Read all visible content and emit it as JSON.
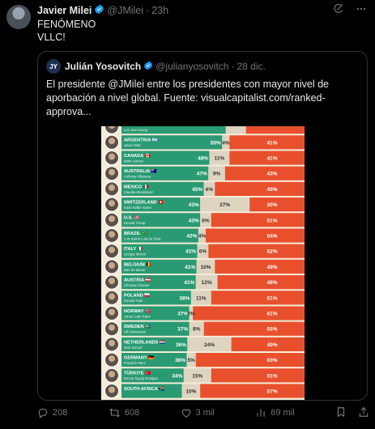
{
  "post": {
    "author_name": "Javier Milei",
    "author_handle": "@JMilei",
    "time": "23h",
    "text_line1": "FENÓMENO",
    "text_line2": "VLLC!"
  },
  "quote": {
    "author_name": "Julián Yosovitch",
    "author_handle": "@julianyosovitch",
    "time": "28 dic.",
    "text": "El presidente @JMilei entre los presidentes con mayor nivel de aporbación a nivel global. Fuente: visualcapitalist.com/ranked-approva..."
  },
  "chart_data": {
    "type": "bar",
    "stacked": true,
    "series_colors": {
      "approve": "#2a9a72",
      "neutral": "#ddd5c0",
      "disapprove": "#e8502d"
    },
    "rows": [
      {
        "country": "",
        "leader": "Lee Jae-myung",
        "flag": "",
        "approve": 57,
        "neutral": 11,
        "disapprove": 32,
        "approve_label": "",
        "neutral_label": "",
        "disapprove_label": ""
      },
      {
        "country": "ARGENTINA",
        "leader": "Javier Milei",
        "flag": "🇦🇷",
        "approve": 55,
        "neutral": 4,
        "disapprove": 41,
        "approve_label": "55%",
        "neutral_label": "4%",
        "disapprove_label": "41%"
      },
      {
        "country": "CANADA",
        "leader": "Mark Carney",
        "flag": "🇨🇦",
        "approve": 48,
        "neutral": 11,
        "disapprove": 41,
        "approve_label": "48%",
        "neutral_label": "11%",
        "disapprove_label": "41%"
      },
      {
        "country": "AUSTRALIA",
        "leader": "Anthony Albanese",
        "flag": "🇦🇺",
        "approve": 47,
        "neutral": 9,
        "disapprove": 43,
        "approve_label": "47%",
        "neutral_label": "9%",
        "disapprove_label": "43%"
      },
      {
        "country": "MEXICO",
        "leader": "Claudia Sheinbaum",
        "flag": "🇲🇽",
        "approve": 45,
        "neutral": 6,
        "disapprove": 49,
        "approve_label": "45%",
        "neutral_label": "6%",
        "disapprove_label": "49%"
      },
      {
        "country": "SWITZERLAND",
        "leader": "Karin Keller-Sutter",
        "flag": "🇨🇭",
        "approve": 43,
        "neutral": 27,
        "disapprove": 30,
        "approve_label": "43%",
        "neutral_label": "27%",
        "disapprove_label": "30%"
      },
      {
        "country": "U.S.",
        "leader": "Donald Trump",
        "flag": "🇺🇸",
        "approve": 43,
        "neutral": 6,
        "disapprove": 51,
        "approve_label": "43%",
        "neutral_label": "6%",
        "disapprove_label": "51%"
      },
      {
        "country": "BRAZIL",
        "leader": "Luiz Inácio Lula da Silva",
        "flag": "🇧🇷",
        "approve": 42,
        "neutral": 4,
        "disapprove": 54,
        "approve_label": "42%",
        "neutral_label": "4%",
        "disapprove_label": "54%"
      },
      {
        "country": "ITALY",
        "leader": "Giorgia Meloni",
        "flag": "🇮🇹",
        "approve": 41,
        "neutral": 6,
        "disapprove": 52,
        "approve_label": "41%",
        "neutral_label": "6%",
        "disapprove_label": "52%"
      },
      {
        "country": "BELGIUM",
        "leader": "Bart de Wever",
        "flag": "🇧🇪",
        "approve": 41,
        "neutral": 10,
        "disapprove": 49,
        "approve_label": "41%",
        "neutral_label": "10%",
        "disapprove_label": "49%"
      },
      {
        "country": "AUSTRIA",
        "leader": "Christian Stocker",
        "flag": "🇦🇹",
        "approve": 41,
        "neutral": 12,
        "disapprove": 48,
        "approve_label": "41%",
        "neutral_label": "12%",
        "disapprove_label": "48%"
      },
      {
        "country": "POLAND",
        "leader": "Donald Tusk",
        "flag": "🇵🇱",
        "approve": 38,
        "neutral": 11,
        "disapprove": 51,
        "approve_label": "38%",
        "neutral_label": "11%",
        "disapprove_label": "51%"
      },
      {
        "country": "NORWAY",
        "leader": "Jonas Gahr Støre",
        "flag": "🇳🇴",
        "approve": 37,
        "neutral": 2,
        "disapprove": 61,
        "approve_label": "37%",
        "neutral_label": "2%",
        "disapprove_label": "61%"
      },
      {
        "country": "SWEDEN",
        "leader": "Ulf Kristersson",
        "flag": "🇸🇪",
        "approve": 37,
        "neutral": 8,
        "disapprove": 55,
        "approve_label": "37%",
        "neutral_label": "8%",
        "disapprove_label": "55%"
      },
      {
        "country": "NETHERLANDS",
        "leader": "Dick Schoof",
        "flag": "🇳🇱",
        "approve": 36,
        "neutral": 24,
        "disapprove": 40,
        "approve_label": "36%",
        "neutral_label": "24%",
        "disapprove_label": "40%"
      },
      {
        "country": "GERMANY",
        "leader": "Friedrich Merz",
        "flag": "🇩🇪",
        "approve": 36,
        "neutral": 5,
        "disapprove": 60,
        "approve_label": "36%",
        "neutral_label": "5%",
        "disapprove_label": "60%"
      },
      {
        "country": "TÜRKIYE",
        "leader": "Recep Tayyip Erdoğan",
        "flag": "🇹🇷",
        "approve": 34,
        "neutral": 15,
        "disapprove": 51,
        "approve_label": "34%",
        "neutral_label": "15%",
        "disapprove_label": "51%"
      },
      {
        "country": "SOUTH AFRICA",
        "leader": "",
        "flag": "🇿🇦",
        "approve": 33,
        "neutral": 10,
        "disapprove": 57,
        "approve_label": "",
        "neutral_label": "10%",
        "disapprove_label": "57%"
      }
    ]
  },
  "actions": {
    "replies": "208",
    "reposts": "608",
    "likes": "3 mil",
    "views": "69 mil"
  },
  "icons": [
    "verified-badge-icon",
    "grok-icon",
    "more-icon",
    "reply-icon",
    "repost-icon",
    "like-icon",
    "views-icon",
    "bookmark-icon",
    "share-icon"
  ]
}
